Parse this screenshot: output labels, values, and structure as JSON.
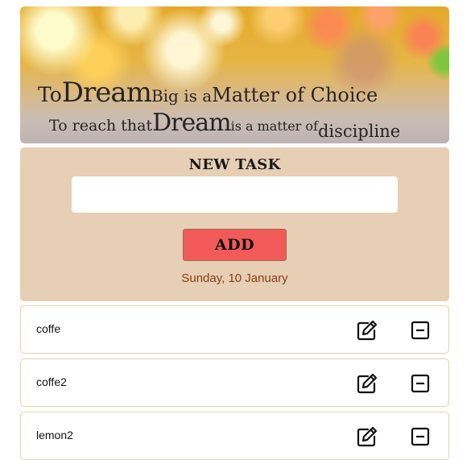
{
  "banner": {
    "quote_line1": {
      "to": "To",
      "dream": "Dream",
      "big_is_a": "Big is a",
      "matter_of_choice": "Matter of Choice"
    },
    "quote_line2": {
      "to_reach_that": "To reach that",
      "dream": "Dream",
      "is_a_matter_of": "is a matter of",
      "discipline": "discipline"
    }
  },
  "new_task": {
    "title": "NEW TASK",
    "input_value": "",
    "input_placeholder": "",
    "add_label": "ADD",
    "date": "Sunday, 10 January"
  },
  "tasks": [
    {
      "text": "coffe",
      "edit_icon": "edit-icon",
      "remove_icon": "minus-square-icon"
    },
    {
      "text": "coffe2",
      "edit_icon": "edit-icon",
      "remove_icon": "minus-square-icon"
    },
    {
      "text": "lemon2",
      "edit_icon": "edit-icon",
      "remove_icon": "minus-square-icon"
    }
  ],
  "colors": {
    "panel_bg": "#e6cfb4",
    "add_button": "#f25a5a",
    "date_text": "#8a3b14",
    "item_border": "#e3d2b6"
  }
}
